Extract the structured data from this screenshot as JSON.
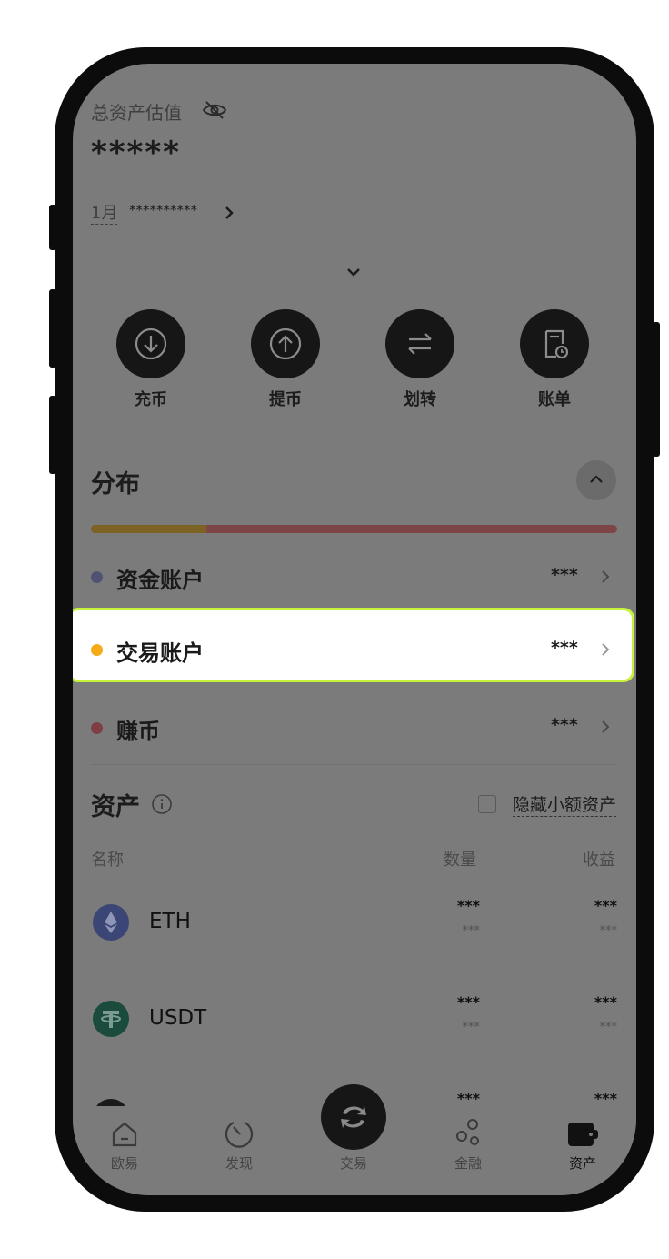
{
  "header": {
    "total_label": "总资产估值",
    "total_value": "*****",
    "month_label": "1月",
    "month_value": "**********"
  },
  "actions": [
    {
      "label": "充币",
      "icon": "download-icon"
    },
    {
      "label": "提币",
      "icon": "upload-icon"
    },
    {
      "label": "划转",
      "icon": "transfer-icon"
    },
    {
      "label": "账单",
      "icon": "bill-icon"
    }
  ],
  "distribution": {
    "title": "分布",
    "bar": [
      {
        "fraction": 0.22,
        "color": "#7d6323"
      },
      {
        "fraction": 0.78,
        "color": "#7e4547"
      }
    ],
    "rows": [
      {
        "name": "资金账户",
        "value": "***",
        "dot": "#505273"
      },
      {
        "name": "交易账户",
        "value": "***",
        "dot": "#f5aa17"
      },
      {
        "name": "赚币",
        "value": "***",
        "dot": "#7e3e44"
      }
    ]
  },
  "assets": {
    "title": "资产",
    "hide_small": "隐藏小额资产",
    "col_name": "名称",
    "col_qty": "数量",
    "col_pnl": "收益",
    "coins": [
      {
        "name": "ETH",
        "qty": "***",
        "qty_sub": "***",
        "pnl": "***",
        "pnl_sub": "***"
      },
      {
        "name": "USDT",
        "qty": "***",
        "qty_sub": "***",
        "pnl": "***",
        "pnl_sub": "***"
      },
      {
        "name": "",
        "qty": "***",
        "pnl": "***"
      }
    ]
  },
  "nav": [
    {
      "label": "欧易",
      "icon": "home-icon"
    },
    {
      "label": "发现",
      "icon": "discover-icon"
    },
    {
      "label": "交易",
      "icon": "trade-icon"
    },
    {
      "label": "金融",
      "icon": "finance-icon"
    },
    {
      "label": "资产",
      "icon": "wallet-icon"
    }
  ]
}
